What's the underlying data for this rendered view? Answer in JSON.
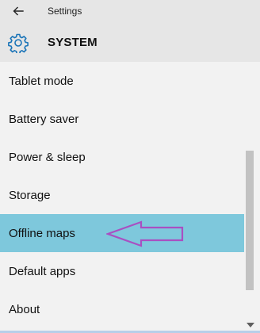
{
  "header": {
    "app_title": "Settings",
    "section_title": "SYSTEM",
    "back_icon": "back-arrow-icon",
    "section_icon": "gear-icon"
  },
  "menu": {
    "items": [
      {
        "label": "Tablet mode"
      },
      {
        "label": "Battery saver"
      },
      {
        "label": "Power & sleep"
      },
      {
        "label": "Storage"
      },
      {
        "label": "Offline maps",
        "selected": true
      },
      {
        "label": "Default apps"
      },
      {
        "label": "About"
      }
    ]
  },
  "colors": {
    "selected_bg": "#7ec8dc",
    "header_bg": "#e6e6e6",
    "page_bg": "#f2f2f2",
    "annotation_arrow": "#a94fc2",
    "accent": "#1a74b8"
  }
}
